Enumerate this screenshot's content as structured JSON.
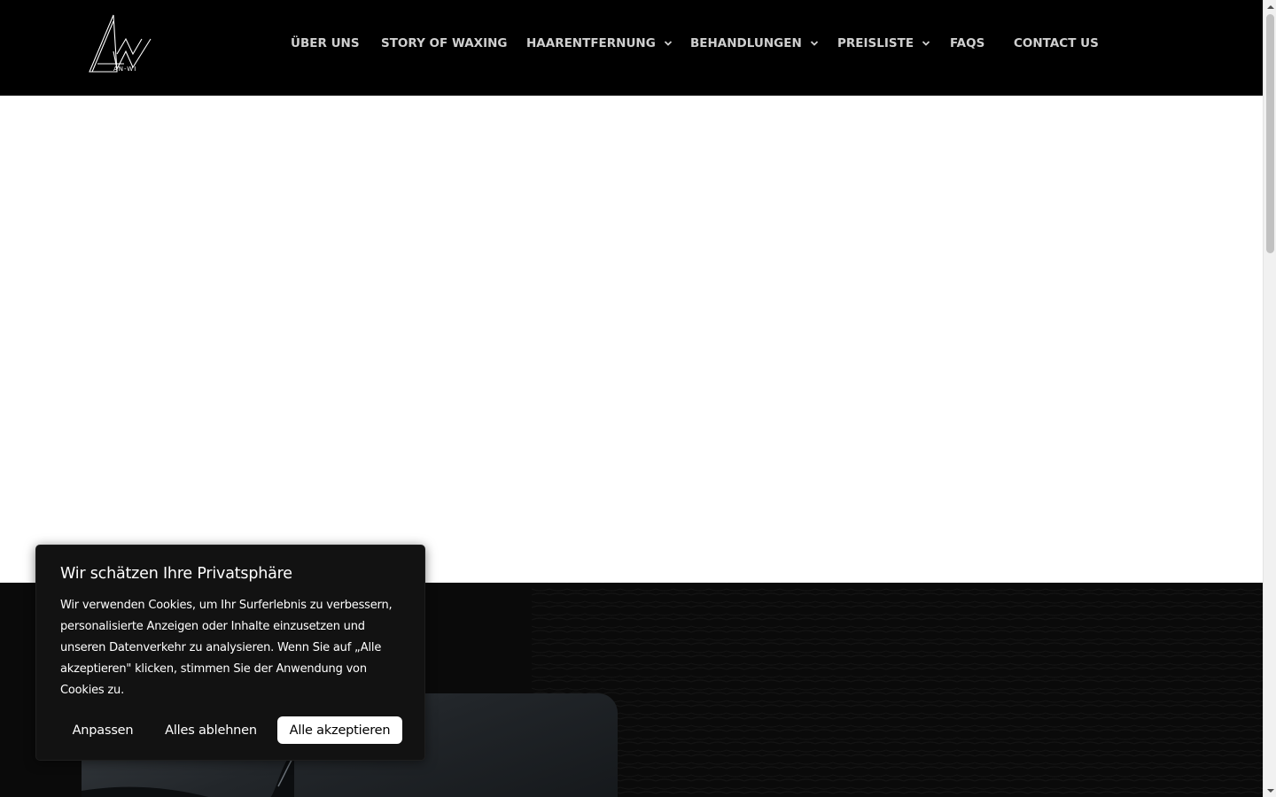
{
  "header": {
    "logo_text": "AN-WI",
    "nav": [
      {
        "label": "ÜBER UNS",
        "dropdown": false
      },
      {
        "label": "STORY OF WAXING",
        "dropdown": false
      },
      {
        "label": "HAARENTFERNUNG",
        "dropdown": true
      },
      {
        "label": "BEHANDLUNGEN",
        "dropdown": true
      },
      {
        "label": "PREISLISTE",
        "dropdown": true
      },
      {
        "label": "FAQS",
        "dropdown": false
      },
      {
        "label": "CONTACT US",
        "dropdown": false
      }
    ]
  },
  "cookie_banner": {
    "title": "Wir schätzen Ihre Privatsphäre",
    "text": "Wir verwenden Cookies, um Ihr Surferlebnis zu verbessern, personalisierte Anzeigen oder Inhalte einzusetzen und unseren Datenverkehr zu analysieren. Wenn Sie auf „Alle akzeptieren\" klicken, stimmen Sie der Anwendung von Cookies zu.",
    "customize_label": "Anpassen",
    "reject_label": "Alles ablehnen",
    "accept_label": "Alle akzeptieren"
  },
  "colors": {
    "header_bg": "#000000",
    "nav_text": "#cfcfcf",
    "banner_bg": "#121212",
    "accept_bg": "#ffffff"
  },
  "icons": [
    "anwi-logo-icon",
    "chevron-down-icon",
    "scroll-up-icon",
    "scroll-down-icon"
  ]
}
